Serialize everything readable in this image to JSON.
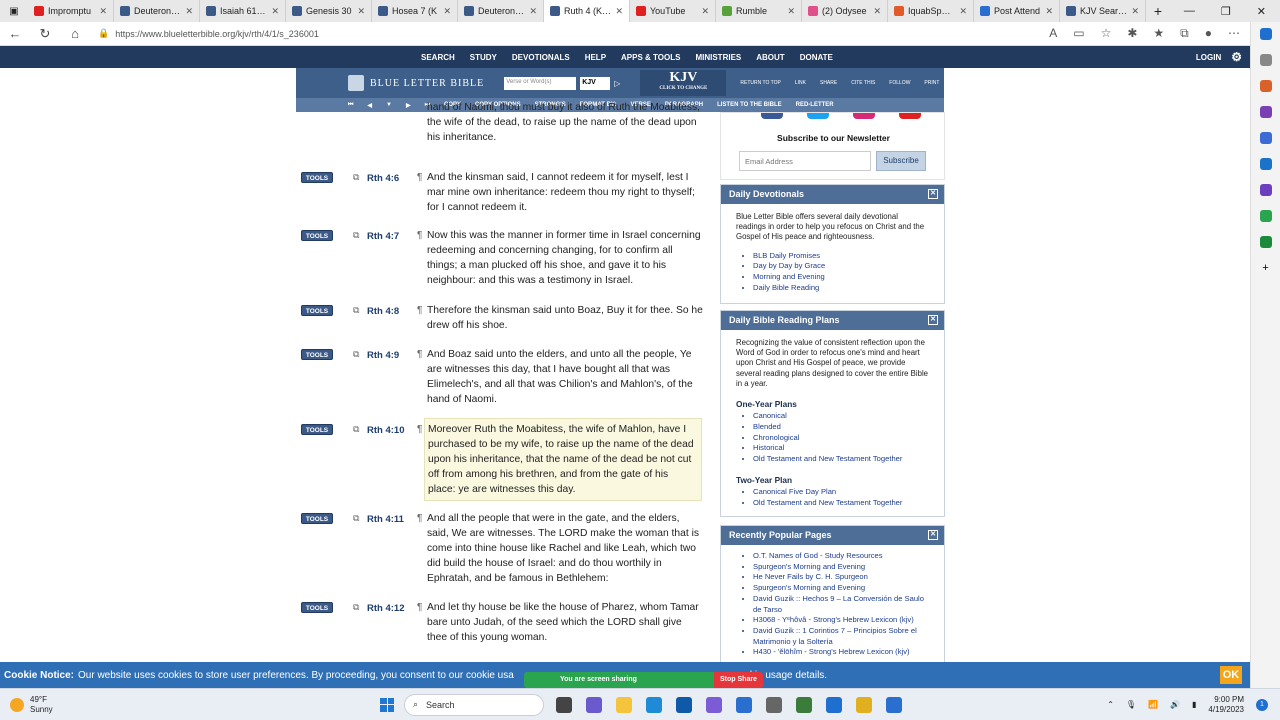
{
  "browser": {
    "tabs": [
      {
        "label": "Impromptu",
        "color": "#e02020"
      },
      {
        "label": "Deuteronom",
        "color": "#3c5a87"
      },
      {
        "label": "Isaiah 61 (K",
        "color": "#3c5a87"
      },
      {
        "label": "Genesis 30",
        "color": "#3c5a87"
      },
      {
        "label": "Hosea 7 (K",
        "color": "#3c5a87"
      },
      {
        "label": "Deuteronom",
        "color": "#3c5a87"
      },
      {
        "label": "Ruth 4 (KJV",
        "color": "#3c5a87"
      },
      {
        "label": "YouTube",
        "color": "#e02020"
      },
      {
        "label": "Rumble",
        "color": "#58a23c"
      },
      {
        "label": "(2) Odysee",
        "color": "#e0508a"
      },
      {
        "label": "IquabSpeck",
        "color": "#e05a2a"
      },
      {
        "label": "Post Attend",
        "color": "#2a6fd0"
      },
      {
        "label": "KJV Search",
        "color": "#3c5a87"
      }
    ],
    "url": "https://www.blueletterbible.org/kjv/rth/4/1/s_236001"
  },
  "site": {
    "nav": [
      "SEARCH",
      "STUDY",
      "DEVOTIONALS",
      "HELP",
      "APPS & TOOLS",
      "MINISTRIES",
      "ABOUT",
      "DONATE"
    ],
    "login": "LOGIN",
    "logo_text": "BLUE LETTER BIBLE",
    "search_placeholder": "Verse or Word(s)",
    "version": "KJV",
    "kjv_big": "KJV",
    "kjv_small": "CLICK TO CHANGE",
    "header_minis": [
      "RETURN TO TOP",
      "LINK",
      "SHARE",
      "CITE THIS",
      "FOLLOW",
      "PRINT"
    ],
    "toolbar": [
      "COPY",
      "COPY OPTIONS",
      "STRONG'S",
      "FORMAT BY:",
      "VERSE",
      "PARAGRAPH",
      "LISTEN TO THE BIBLE",
      "RED-LETTER"
    ]
  },
  "verses": [
    {
      "ref": "",
      "text": "hand of Naomi, thou must buy it also of Ruth the Moabitess, the wife of the dead, to raise up the name of the dead upon his inheritance."
    },
    {
      "ref": "Rth 4:6",
      "text": "And the kinsman said, I cannot redeem it for myself, lest I mar mine own inheritance: redeem thou my right to thyself; for I cannot redeem it."
    },
    {
      "ref": "Rth 4:7",
      "text": "Now this was the manner in former time in Israel concerning redeeming and concerning changing, for to confirm all things; a man plucked off his shoe, and gave it to his neighbour: and this was a testimony in Israel."
    },
    {
      "ref": "Rth 4:8",
      "text": "Therefore the kinsman said unto Boaz, Buy it for thee. So he drew off his shoe."
    },
    {
      "ref": "Rth 4:9",
      "text": "And Boaz said unto the elders, and unto all the people, Ye are witnesses this day, that I have bought all that was Elimelech's, and all that was Chilion's and Mahlon's, of the hand of Naomi."
    },
    {
      "ref": "Rth 4:10",
      "text": "Moreover Ruth the Moabitess, the wife of Mahlon, have I purchased to be my wife, to raise up the name of the dead upon his inheritance, that the name of the dead be not cut off from among his brethren, and from the gate of his place: ye are witnesses this day."
    },
    {
      "ref": "Rth 4:11",
      "text": "And all the people that were in the gate, and the elders, said, We are witnesses. The LORD make the woman that is come into thine house like Rachel and like Leah, which two did build the house of Israel: and do thou worthily in Ephratah, and be famous in Bethlehem:"
    },
    {
      "ref": "Rth 4:12",
      "text": "And let thy house be like the house of Pharez, whom Tamar bare unto Judah, of the seed which the LORD shall give thee of this young woman."
    }
  ],
  "tools_label": "TOOLS",
  "newsletter": {
    "title": "Subscribe to our Newsletter",
    "placeholder": "Email Address",
    "button": "Subscribe"
  },
  "devotionals": {
    "title": "Daily Devotionals",
    "intro": "Blue Letter Bible offers several daily devotional readings in order to help you refocus on Christ and the Gospel of His peace and righteousness.",
    "links": [
      "BLB Daily Promises",
      "Day by Day by Grace",
      "Morning and Evening",
      "Daily Bible Reading"
    ]
  },
  "plans": {
    "title": "Daily Bible Reading Plans",
    "intro": "Recognizing the value of consistent reflection upon the Word of God in order to refocus one's mind and heart upon Christ and His Gospel of peace, we provide several reading plans designed to cover the entire Bible in a year.",
    "one_year_heading": "One-Year Plans",
    "one_year": [
      "Canonical",
      "Blended",
      "Chronological",
      "Historical",
      "Old Testament and New Testament Together"
    ],
    "two_year_heading": "Two-Year Plan",
    "two_year": [
      "Canonical Five Day Plan",
      "Old Testament and New Testament Together"
    ]
  },
  "popular": {
    "title": "Recently Popular Pages",
    "links": [
      "O.T. Names of God - Study Resources",
      "Spurgeon's Morning and Evening",
      "He Never Fails by C. H. Spurgeon",
      "Spurgeon's Morning and Evening",
      "David Guzik :: Hechos 9 – La Conversión de Saulo de Tarso",
      "H3068 - Yᵉhôvâ - Strong's Hebrew Lexicon (kjv)",
      "David Guzik :: 1 Corintios 7 – Principios Sobre el Matrimonio y la Soltería",
      "H430 - 'ĕlōhîm - Strong's Hebrew Lexicon (kjv)"
    ]
  },
  "cookie": {
    "title": "Cookie Notice:",
    "text": "Our website uses cookies to store user preferences. By proceeding, you consent to our cookie usa",
    "trail": "kie usage details.",
    "ok": "OK"
  },
  "screen_share": {
    "label": "You are screen sharing",
    "stop": "Stop Share"
  },
  "taskbar": {
    "temp": "49°F",
    "condition": "Sunny",
    "search": "Search",
    "time": "9:00 PM",
    "date": "4/19/2023"
  }
}
